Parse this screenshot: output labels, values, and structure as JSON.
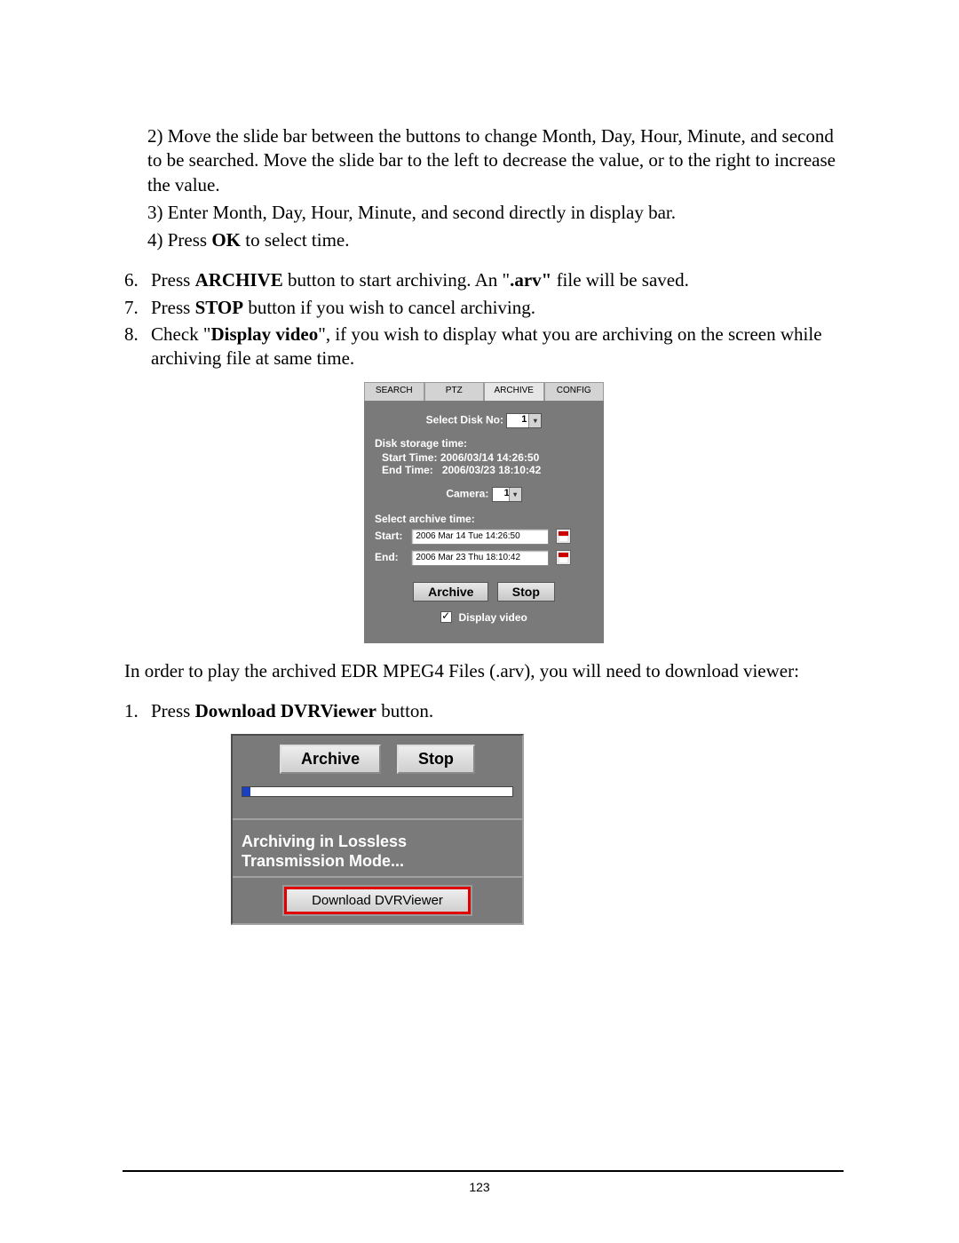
{
  "body": {
    "step2": "2) Move the slide bar between the buttons to change Month, Day, Hour, Minute, and second to be searched. Move the slide bar to the left to decrease the value, or to the right to increase the value.",
    "step3": "3) Enter Month, Day, Hour, Minute, and second directly in display bar.",
    "step4_pre": "4) Press ",
    "step4_b": "OK",
    "step4_post": " to select time.",
    "item6_num": "6.",
    "item6_pre": "Press ",
    "item6_b1": "ARCHIVE",
    "item6_mid": " button to start archiving. An \"",
    "item6_b2": ".arv\"",
    "item6_post": " file will be saved.",
    "item7_num": "7.",
    "item7_pre": "Press ",
    "item7_b": "STOP",
    "item7_post": " button if you wish to cancel archiving.",
    "item8_num": "8.",
    "item8_pre": "Check \"",
    "item8_b": "Display video",
    "item8_post": "\", if you wish to display what you are archiving on the screen while archiving file at same time.",
    "post_para": "In order to play the archived EDR MPEG4 Files (.arv), you will need to download viewer:",
    "step1b_num": "1.",
    "step1b_pre": "Press ",
    "step1b_b": "Download DVRViewer",
    "step1b_post": " button."
  },
  "archive_panel": {
    "tabs": {
      "search": "SEARCH",
      "ptz": "PTZ",
      "archive": "ARCHIVE",
      "config": "CONFIG"
    },
    "disk_label": "Select Disk No:",
    "disk_value": "1",
    "storage_title": "Disk storage time:",
    "start_time_label": "Start Time:",
    "start_time_val": "2006/03/14 14:26:50",
    "end_time_label": "End Time:",
    "end_time_val": "2006/03/23 18:10:42",
    "camera_label": "Camera:",
    "camera_value": "1",
    "archive_time_title": "Select archive time:",
    "start_label": "Start:",
    "start_val": "2006 Mar 14 Tue 14:26:50",
    "end_label": "End:",
    "end_val": "2006 Mar 23 Thu 18:10:42",
    "archive_btn": "Archive",
    "stop_btn": "Stop",
    "display_video": "Display video"
  },
  "dl_panel": {
    "archive_btn": "Archive",
    "stop_btn": "Stop",
    "status_l1": "Archiving in Lossless",
    "status_l2": "Transmission Mode...",
    "download_btn": "Download DVRViewer"
  },
  "footer": {
    "page_num": "123"
  }
}
